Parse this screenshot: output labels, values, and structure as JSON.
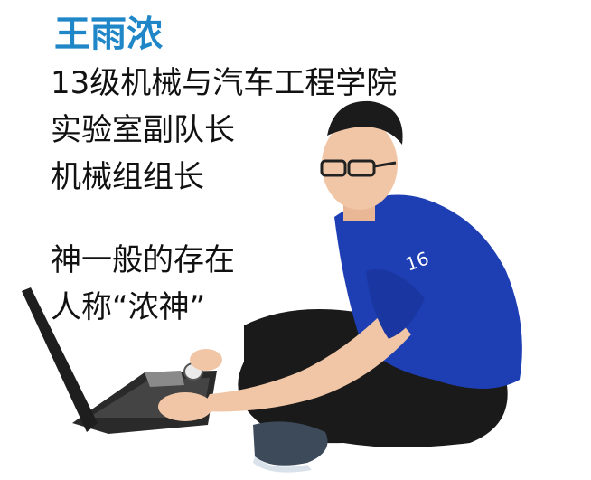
{
  "profile": {
    "name": "王雨浓",
    "lines": [
      "13级机械与汽车工程学院",
      "实验室副队长",
      "机械组组长"
    ],
    "tagline": [
      "神一般的存在",
      "人称“浓神”"
    ]
  },
  "shirt_print": "16",
  "colors": {
    "name": "#1f86c8",
    "text": "#111111",
    "shirt": "#1e3fb3",
    "pants": "#1a1a1a",
    "laptop": "#2a2a2a",
    "skin": "#f1c6a6"
  }
}
